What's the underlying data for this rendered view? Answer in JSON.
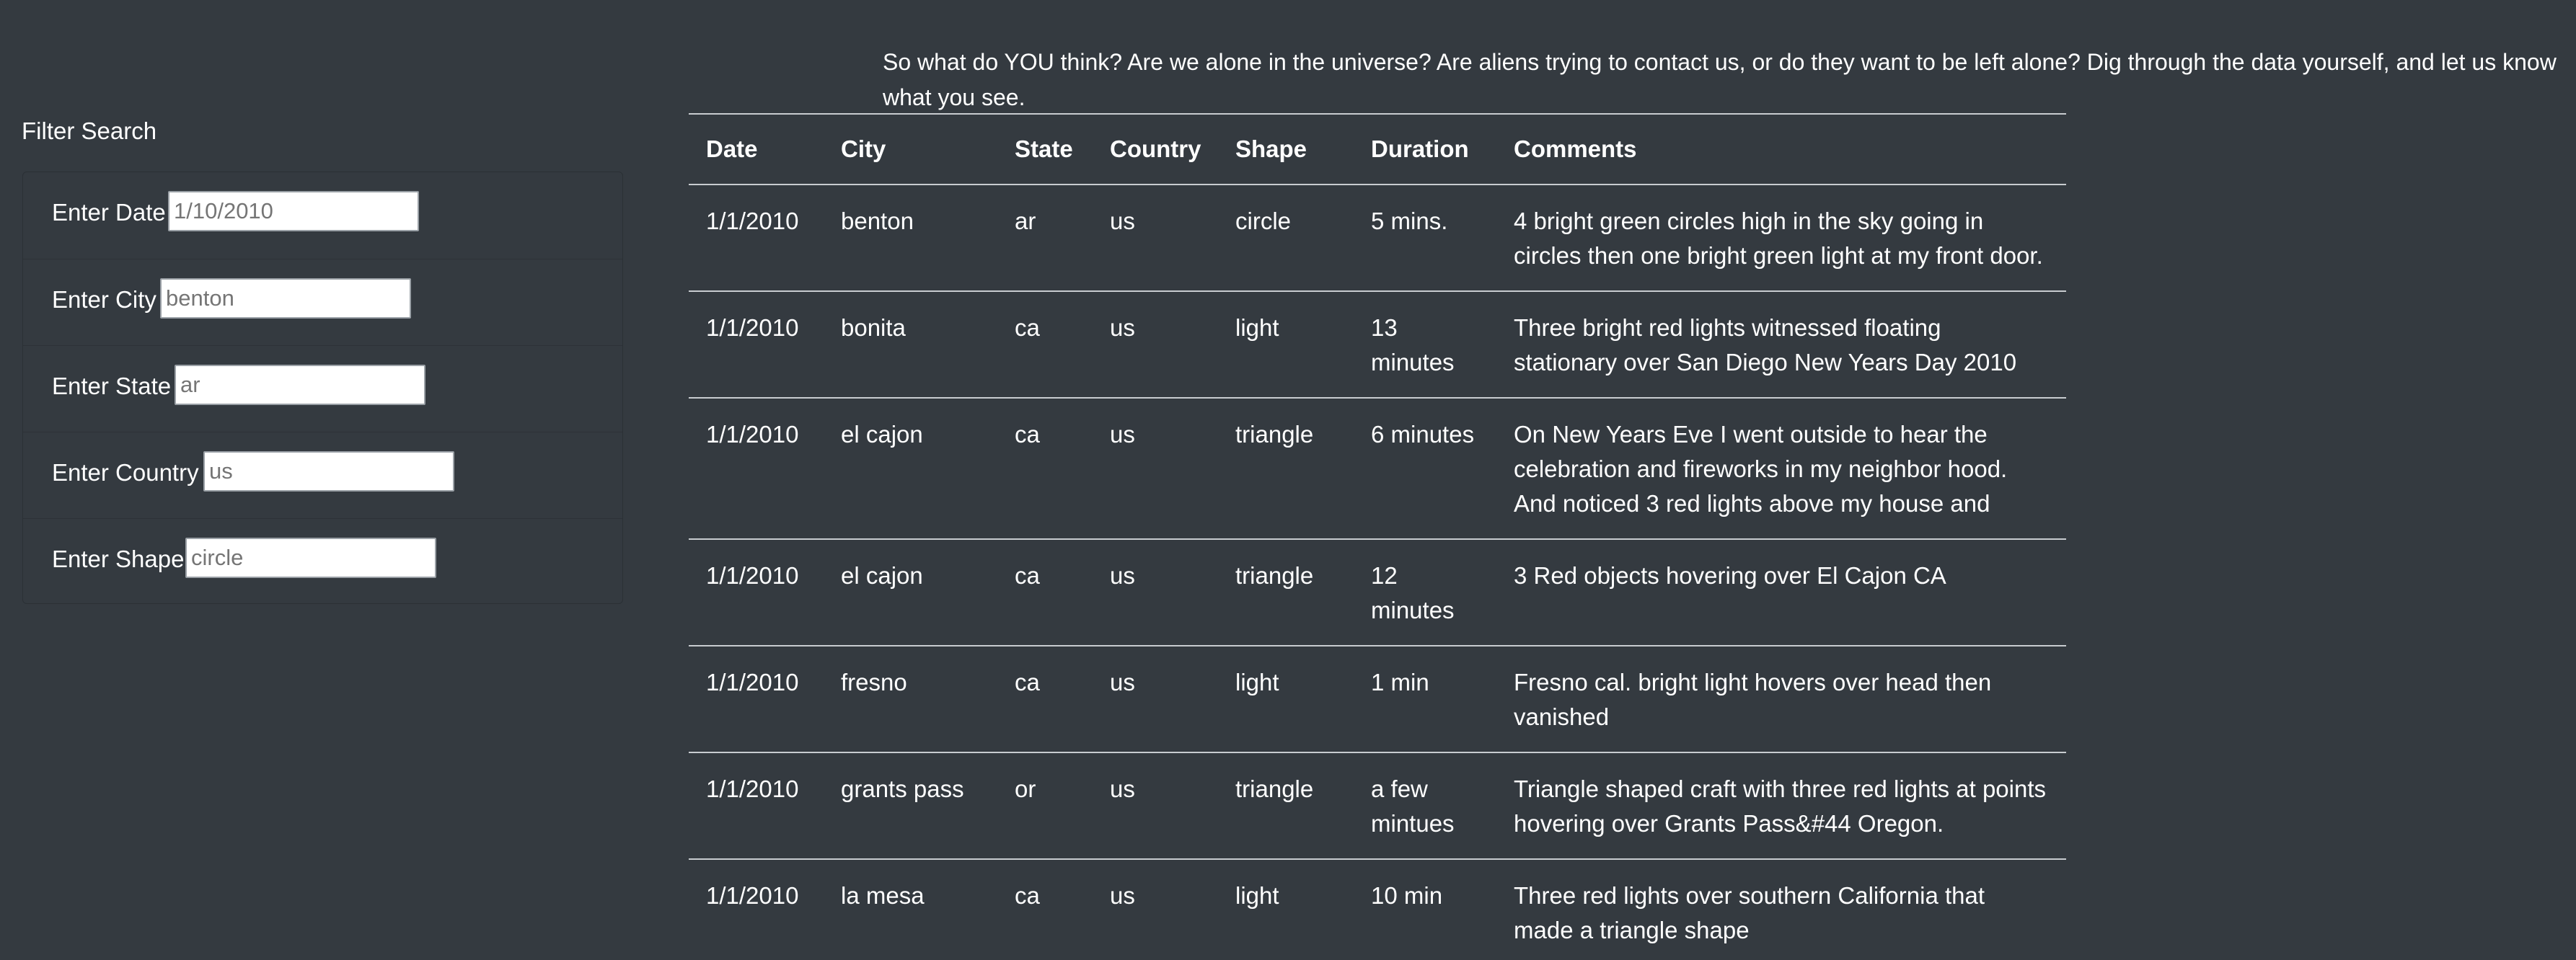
{
  "intro": {
    "text": "So what do YOU think? Are we alone in the universe? Are aliens trying to contact us, or do they want to be left alone? Dig through the data yourself, and let us know what you see."
  },
  "filters": {
    "title": "Filter Search",
    "items": [
      {
        "label": "Enter Date",
        "placeholder": "1/10/2010"
      },
      {
        "label": "Enter City",
        "placeholder": "benton"
      },
      {
        "label": "Enter State",
        "placeholder": "ar"
      },
      {
        "label": "Enter Country",
        "placeholder": "us"
      },
      {
        "label": "Enter Shape",
        "placeholder": "circle"
      }
    ]
  },
  "table": {
    "headers": [
      "Date",
      "City",
      "State",
      "Country",
      "Shape",
      "Duration",
      "Comments"
    ],
    "rows": [
      [
        "1/1/2010",
        "benton",
        "ar",
        "us",
        "circle",
        "5 mins.",
        "4 bright green circles high in the sky going in circles then one bright green light at my front door."
      ],
      [
        "1/1/2010",
        "bonita",
        "ca",
        "us",
        "light",
        "13 minutes",
        "Three bright red lights witnessed floating stationary over San Diego New Years Day 2010"
      ],
      [
        "1/1/2010",
        "el cajon",
        "ca",
        "us",
        "triangle",
        "6 minutes",
        "On New Years Eve I went outside to hear the celebration and fireworks in my neighbor hood. And noticed 3 red lights above my house and"
      ],
      [
        "1/1/2010",
        "el cajon",
        "ca",
        "us",
        "triangle",
        "12 minutes",
        "3 Red objects hovering over El Cajon CA"
      ],
      [
        "1/1/2010",
        "fresno",
        "ca",
        "us",
        "light",
        "1 min",
        "Fresno cal. bright light hovers over head then vanished"
      ],
      [
        "1/1/2010",
        "grants pass",
        "or",
        "us",
        "triangle",
        "a few mintues",
        "Triangle shaped craft with three red lights at points hovering over Grants Pass&#44 Oregon."
      ],
      [
        "1/1/2010",
        "la mesa",
        "ca",
        "us",
        "light",
        "10 min",
        "Three red lights over southern California that made a triangle shape"
      ]
    ]
  }
}
